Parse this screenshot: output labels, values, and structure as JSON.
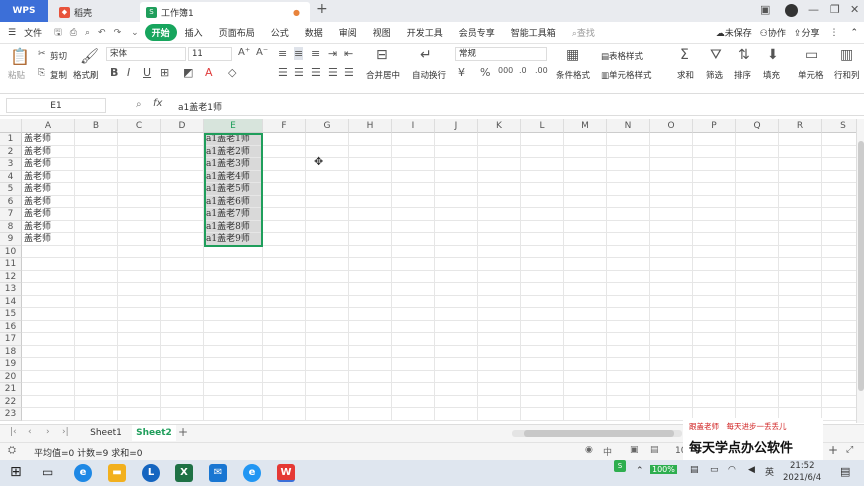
{
  "titlebar": {
    "wps": "WPS",
    "tab2": "稻壳",
    "tab3": "工作簿1",
    "plus": "+"
  },
  "menubar": {
    "file": "文件",
    "items": [
      "开始",
      "插入",
      "页面布局",
      "公式",
      "数据",
      "审阅",
      "视图",
      "开发工具",
      "会员专享",
      "智能工具箱"
    ],
    "search": "查找",
    "unsaved": "未保存",
    "collab": "协作",
    "share": "分享"
  },
  "ribbon": {
    "cut": "剪切",
    "copy": "复制",
    "paste": "粘贴",
    "format_painter": "格式刷",
    "font": "宋体",
    "size": "11",
    "merge": "合并居中",
    "wrap": "自动换行",
    "numfmt": "常规",
    "table_style": "表格样式",
    "cond_fmt": "条件格式",
    "cell_style": "单元格样式",
    "sum": "求和",
    "filter": "筛选",
    "sort": "排序",
    "fill": "填充",
    "cell": "单元格",
    "rowcol": "行和列"
  },
  "formula": {
    "namebox": "E1",
    "fx": "fx",
    "value": "a1盖老1师"
  },
  "columns": [
    "A",
    "B",
    "C",
    "D",
    "E",
    "F",
    "G",
    "H",
    "I",
    "J",
    "K",
    "L",
    "M",
    "N",
    "O",
    "P",
    "Q",
    "R",
    "S"
  ],
  "rows": [
    "1",
    "2",
    "3",
    "4",
    "5",
    "6",
    "7",
    "8",
    "9",
    "10",
    "11",
    "12",
    "13",
    "14",
    "15",
    "16",
    "17",
    "18",
    "19",
    "20",
    "21",
    "22",
    "23"
  ],
  "colA": [
    "盖老师",
    "盖老师",
    "盖老师",
    "盖老师",
    "盖老师",
    "盖老师",
    "盖老师",
    "盖老师",
    "盖老师"
  ],
  "colE": [
    "a1盖老1师",
    "a1盖老2师",
    "a1盖老3师",
    "a1盖老4师",
    "a1盖老5师",
    "a1盖老6师",
    "a1盖老7师",
    "a1盖老8师",
    "a1盖老9师"
  ],
  "sheets": [
    "Sheet1",
    "Sheet2"
  ],
  "status": {
    "stats": "平均值=0 计数=9 求和=0",
    "zoom": "100%",
    "zoomnum": "10"
  },
  "watermark": {
    "line1": "跟盖老师　每天进步一丢丢儿",
    "line2": "每天学点办公软件"
  },
  "taskbar": {
    "time": "21:52",
    "date": "2021/6/4",
    "battery": "100%"
  },
  "colors": {
    "accent": "#1f9e5b",
    "wps_blue": "#3c6fd8"
  }
}
